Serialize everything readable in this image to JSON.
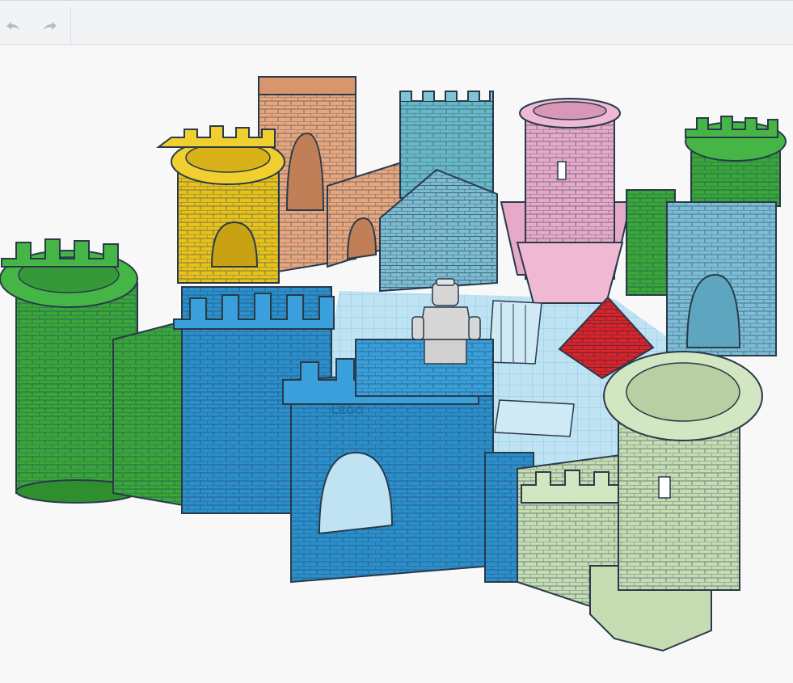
{
  "toolbar": {
    "undo_icon": "undo-arrow-icon",
    "redo_icon": "redo-arrow-icon"
  },
  "scene": {
    "minifig_label": "LEGO",
    "colors": {
      "workplane": "#bfe3f3",
      "grid": "#8fcbe6",
      "blue_gate": "#2b8fcb",
      "green_tower": "#3aa63a",
      "sage_tower": "#c6dcb2",
      "yellow_tower": "#e8c21c",
      "tan_wall": "#e7a67d",
      "teal_tower": "#69b8c7",
      "pink_tower": "#e6a9c7",
      "light_blue_house": "#7cbdd4",
      "pyramid": "#d8232a",
      "minifig": "#d7d7d7",
      "outline": "#2a3a4a"
    }
  }
}
